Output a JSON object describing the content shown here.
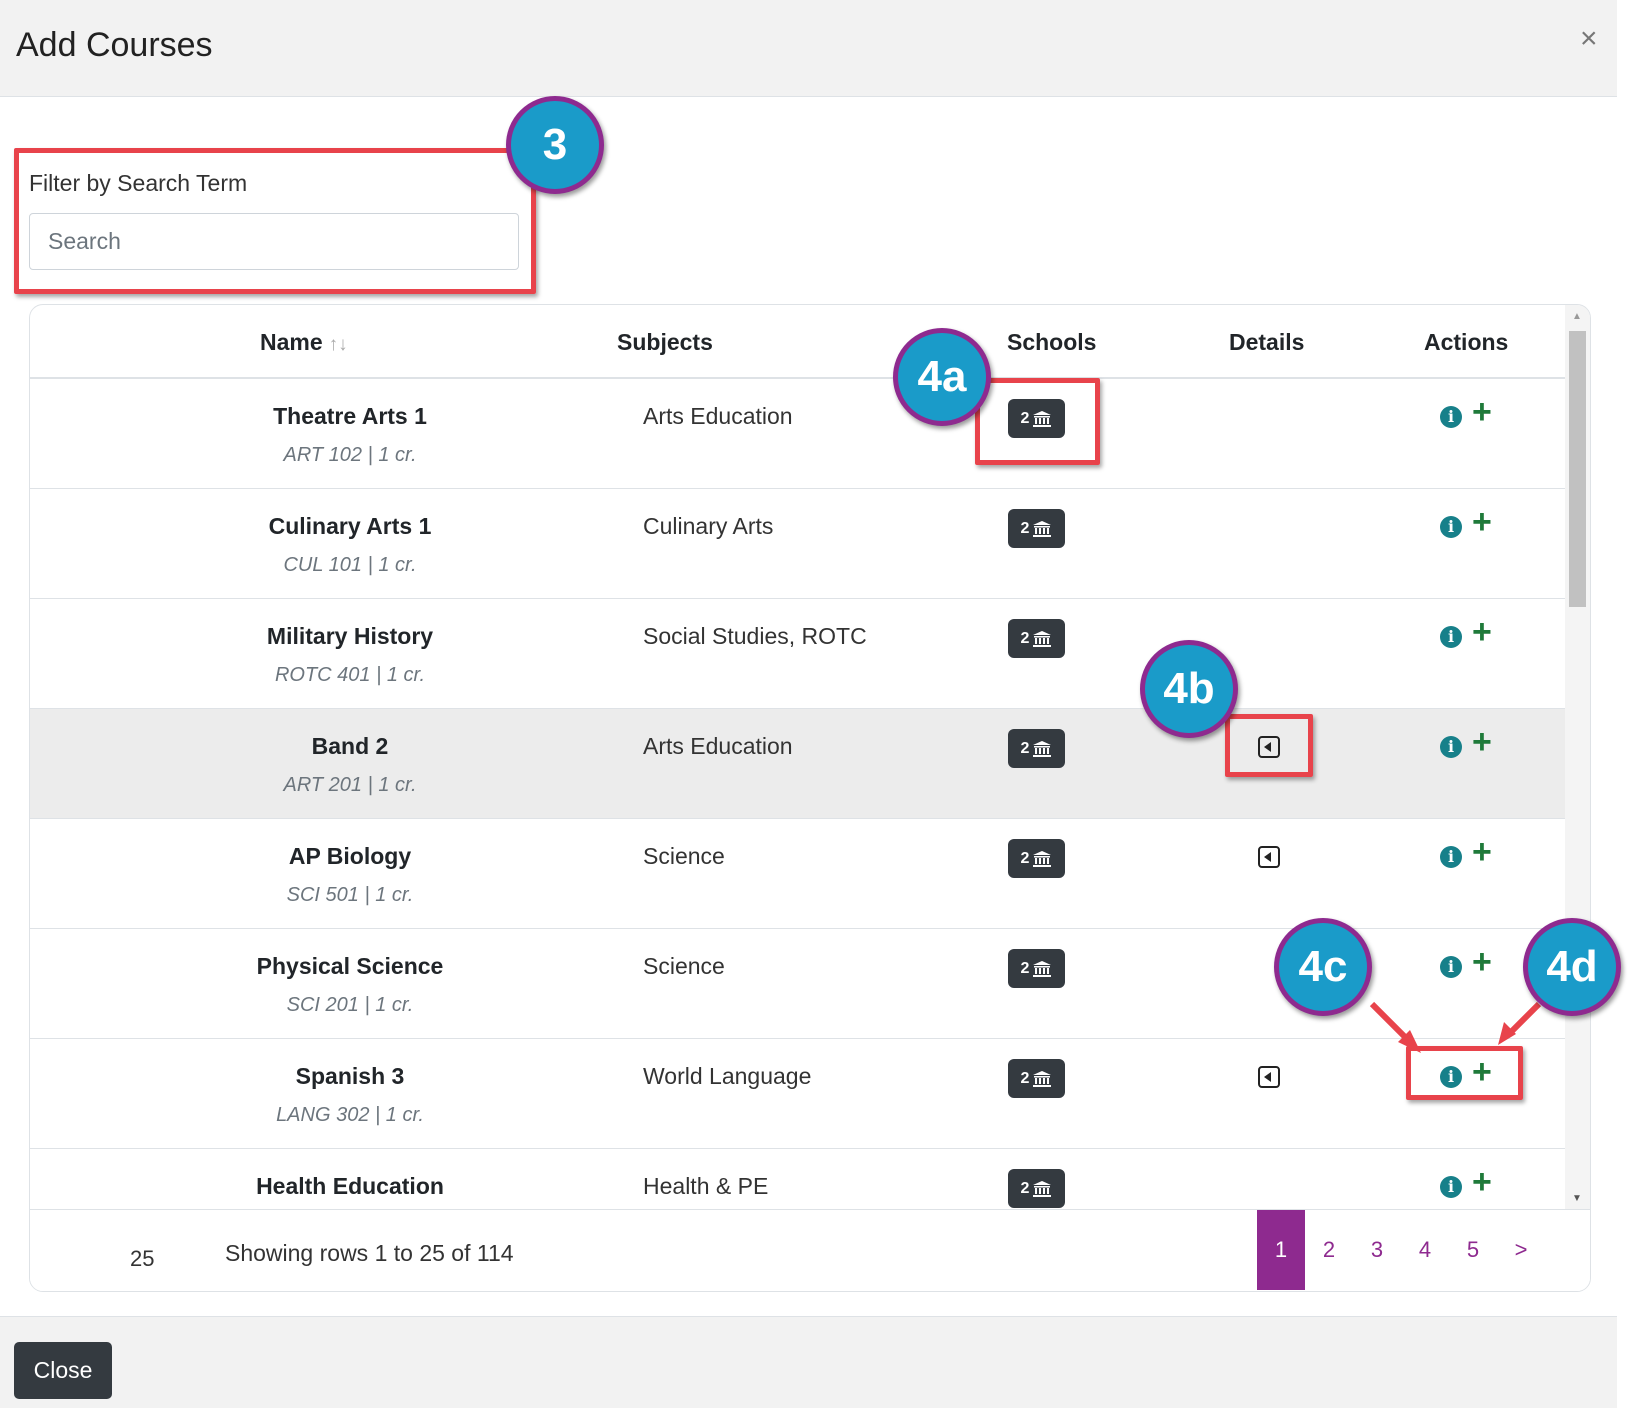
{
  "modal": {
    "title": "Add Courses",
    "close_symbol": "×"
  },
  "filter": {
    "label": "Filter by Search Term",
    "placeholder": "Search",
    "value": ""
  },
  "table": {
    "headers": {
      "name": "Name",
      "name_sort": "↑↓",
      "subjects": "Subjects",
      "schools": "Schools",
      "details": "Details",
      "actions": "Actions"
    },
    "rows": [
      {
        "name": "Theatre Arts 1",
        "code": "ART 102 | 1 cr.",
        "subjects": "Arts Education",
        "schools": "2",
        "has_details": false,
        "highlighted": false
      },
      {
        "name": "Culinary Arts 1",
        "code": "CUL 101 | 1 cr.",
        "subjects": "Culinary Arts",
        "schools": "2",
        "has_details": false,
        "highlighted": false
      },
      {
        "name": "Military History",
        "code": "ROTC 401 | 1 cr.",
        "subjects": "Social Studies, ROTC",
        "schools": "2",
        "has_details": false,
        "highlighted": false
      },
      {
        "name": "Band 2",
        "code": "ART 201 | 1 cr.",
        "subjects": "Arts Education",
        "schools": "2",
        "has_details": true,
        "highlighted": true
      },
      {
        "name": "AP Biology",
        "code": "SCI 501 | 1 cr.",
        "subjects": "Science",
        "schools": "2",
        "has_details": true,
        "highlighted": false
      },
      {
        "name": "Physical Science",
        "code": "SCI 201 | 1 cr.",
        "subjects": "Science",
        "schools": "2",
        "has_details": false,
        "highlighted": false
      },
      {
        "name": "Spanish 3",
        "code": "LANG 302 | 1 cr.",
        "subjects": "World Language",
        "schools": "2",
        "has_details": true,
        "highlighted": false
      },
      {
        "name": "Health Education",
        "code": "",
        "subjects": "Health & PE",
        "schools": "2",
        "has_details": false,
        "highlighted": false
      }
    ],
    "icons": {
      "school": "institution-icon",
      "details": "caret-square-left-icon",
      "info": "info-circle-icon",
      "add": "plus-icon"
    }
  },
  "footer": {
    "page_size": "25",
    "rows_info": "Showing rows 1 to 25 of 114",
    "pages": [
      "1",
      "2",
      "3",
      "4",
      "5",
      ">"
    ],
    "active_page": "1"
  },
  "close_button": "Close",
  "callouts": {
    "search": "3",
    "schools": "4a",
    "details": "4b",
    "info": "4c",
    "add": "4d"
  },
  "colors": {
    "accent": "#8e2a8f",
    "callout_fill": "#1a9bc9",
    "callout_border": "#8e2a8f",
    "highlight_box": "#e8434b",
    "info": "#17808a",
    "add": "#1f7a3a",
    "badge": "#343a40"
  }
}
